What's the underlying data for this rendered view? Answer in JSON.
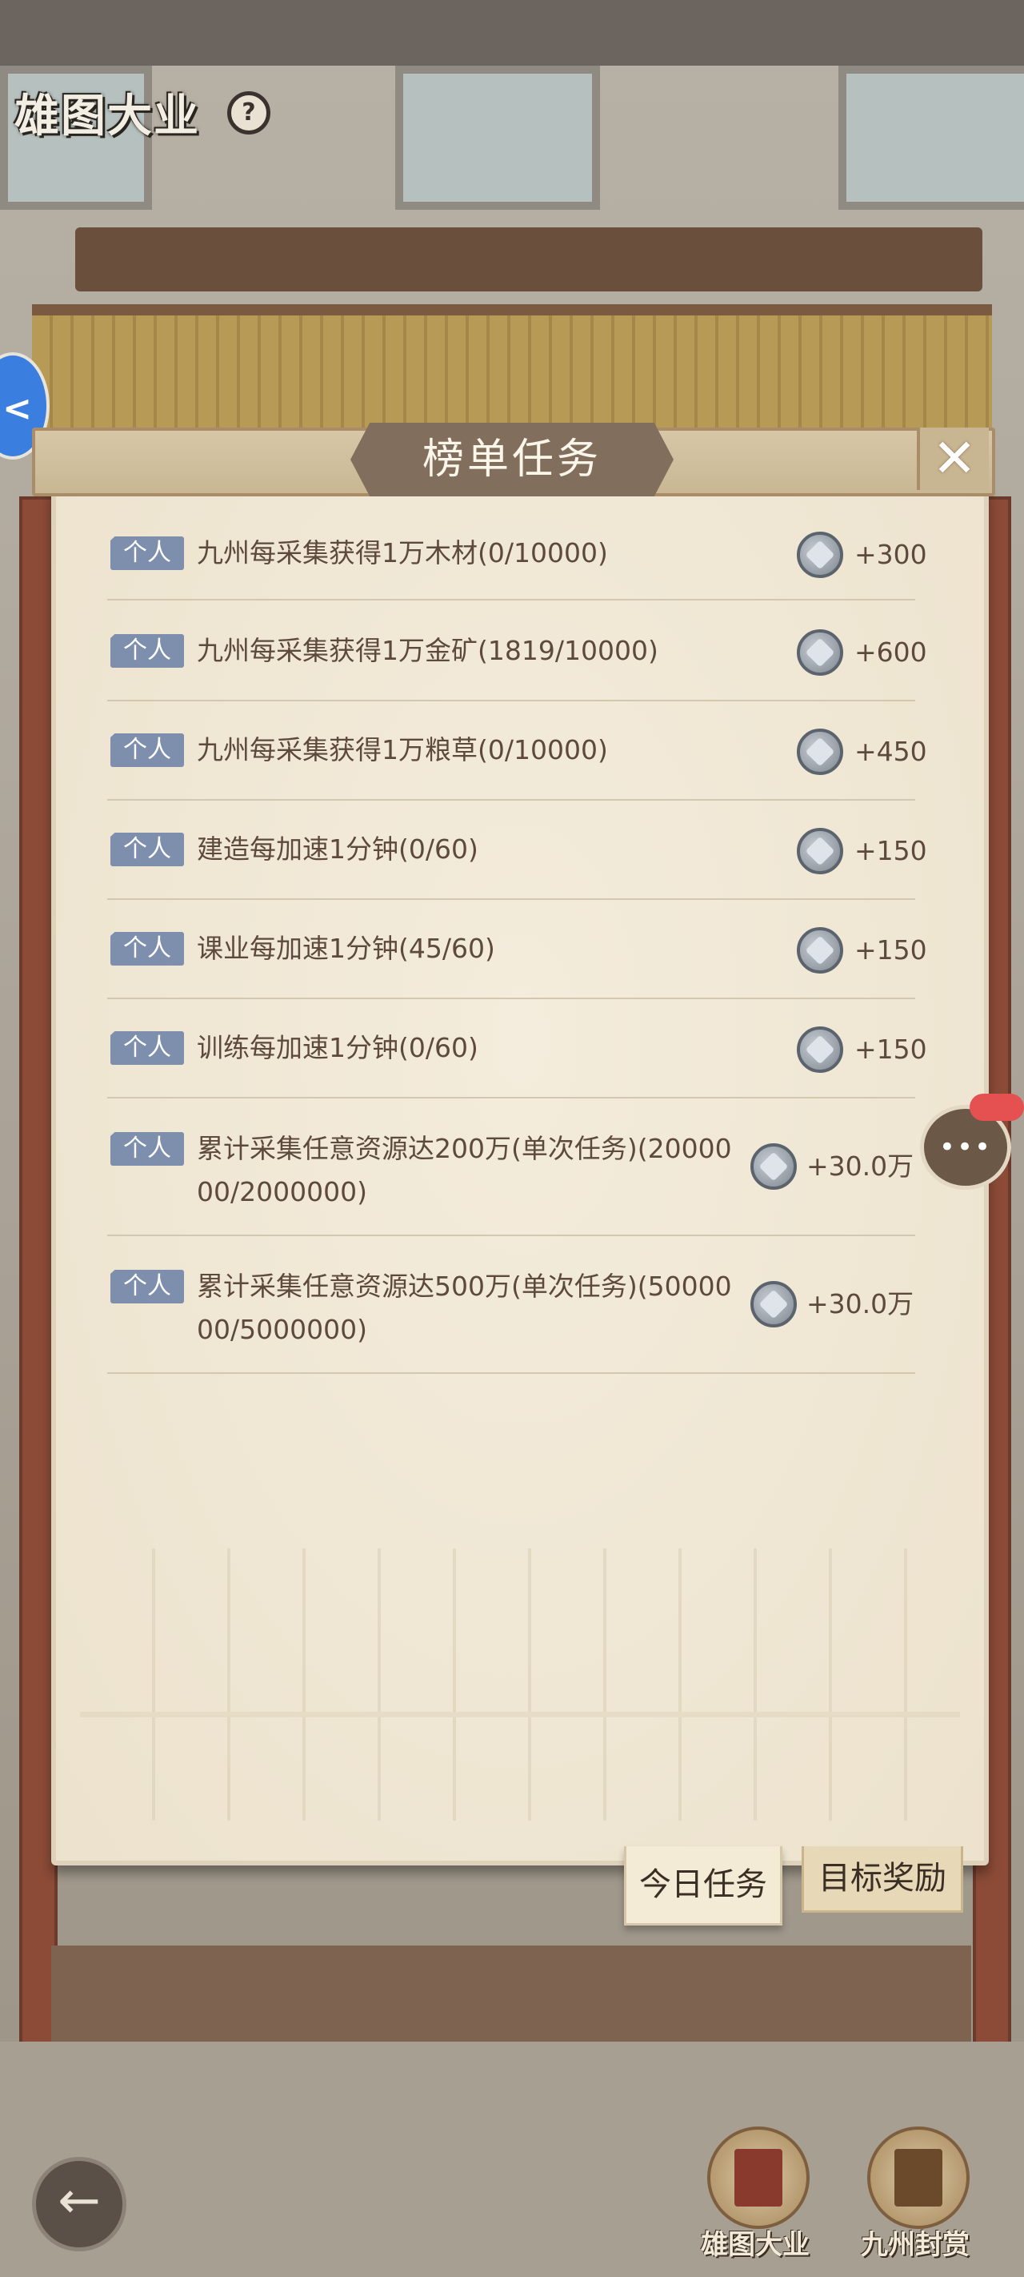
{
  "game": {
    "title": "雄图大业",
    "help_icon": "question-icon"
  },
  "panel": {
    "title": "榜单任务",
    "close_icon": "close-icon"
  },
  "tasks": [
    {
      "tag": "个人",
      "text": "九州每采集获得1万木材(0/10000)",
      "reward": "+300"
    },
    {
      "tag": "个人",
      "text": "九州每采集获得1万金矿(1819/10000)",
      "reward": "+600"
    },
    {
      "tag": "个人",
      "text": "九州每采集获得1万粮草(0/10000)",
      "reward": "+450"
    },
    {
      "tag": "个人",
      "text": "建造每加速1分钟(0/60)",
      "reward": "+150"
    },
    {
      "tag": "个人",
      "text": "课业每加速1分钟(45/60)",
      "reward": "+150"
    },
    {
      "tag": "个人",
      "text": "训练每加速1分钟(0/60)",
      "reward": "+150"
    },
    {
      "tag": "个人",
      "text": "累计采集任意资源达200万(单次任务)(2000000/2000000)",
      "reward": "+30.0万"
    },
    {
      "tag": "个人",
      "text": "累计采集任意资源达500万(单次任务)(5000000/5000000)",
      "reward": "+30.0万"
    }
  ],
  "tabs": {
    "today": "今日任务",
    "goal": "目标奖励"
  },
  "bottom_nav": [
    {
      "label": "雄图大业",
      "icon": "book-icon"
    },
    {
      "label": "九州封赏",
      "icon": "treasure-chest-icon"
    }
  ],
  "icons": {
    "back": "back-arrow-icon",
    "chat": "chat-bubble-icon",
    "coin": "silver-coin-icon"
  },
  "colors": {
    "tag_bg": "#7d8fad",
    "panel_bg": "#f1e8d6",
    "text": "#5d4a3c"
  }
}
